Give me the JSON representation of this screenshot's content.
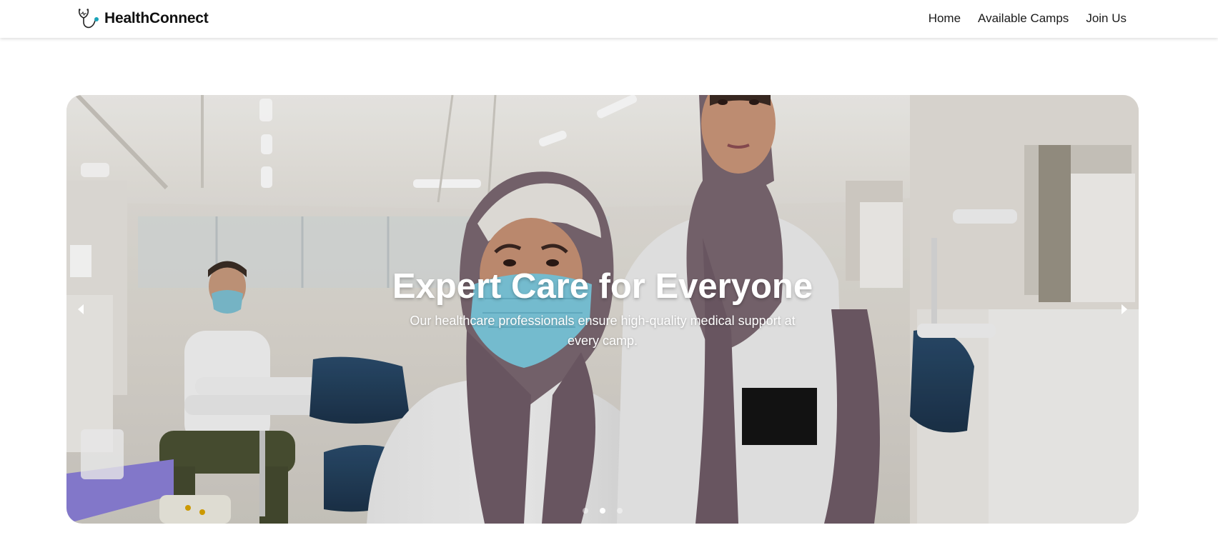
{
  "brand": {
    "name": "HealthConnect",
    "icon": "stethoscope-icon",
    "accent": "#1aa3b8"
  },
  "nav": {
    "items": [
      {
        "label": "Home"
      },
      {
        "label": "Available Camps"
      },
      {
        "label": "Join Us"
      }
    ]
  },
  "hero": {
    "title": "Expert Care for Everyone",
    "text": "Our healthcare professionals ensure high-quality medical support at every camp.",
    "prev_icon": "chevron-left-icon",
    "next_icon": "chevron-right-icon",
    "slide_count": 3,
    "active_slide": 2
  }
}
